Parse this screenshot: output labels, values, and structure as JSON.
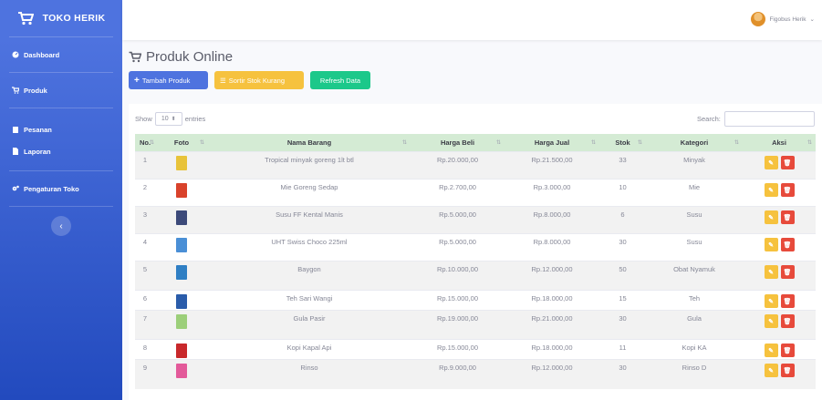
{
  "sidebar": {
    "brand": "TOKO HERIK",
    "items": [
      {
        "label": "Dashboard",
        "icon": "tachometer-icon"
      },
      {
        "label": "Produk",
        "icon": "cart-icon"
      },
      {
        "label": "Pesanan",
        "icon": "clipboard-icon"
      },
      {
        "label": "Laporan",
        "icon": "file-icon"
      },
      {
        "label": "Pengaturan Toko",
        "icon": "cogs-icon"
      }
    ],
    "toggle": "‹"
  },
  "topbar": {
    "user_name": "Figobus Herik"
  },
  "page": {
    "title": "Produk Online"
  },
  "buttons": {
    "add": "Tambah Produk",
    "sort": "Sortir Stok Kurang",
    "refresh": "Refresh Data"
  },
  "table_controls": {
    "show": "Show",
    "entries_value": "10",
    "entries": "entries",
    "search": "Search:"
  },
  "table": {
    "headers": [
      "No.",
      "Foto",
      "Nama Barang",
      "Harga Beli",
      "Harga Jual",
      "Stok",
      "Kategori",
      "Aksi"
    ],
    "rows": [
      {
        "no": "1",
        "nama": "Tropical minyak goreng 1lt btl",
        "beli": "Rp.20.000,00",
        "jual": "Rp.21.500,00",
        "stok": "33",
        "kategori": "Minyak",
        "photo_color": "#e8c33a"
      },
      {
        "no": "2",
        "nama": "Mie Goreng Sedap",
        "beli": "Rp.2.700,00",
        "jual": "Rp.3.000,00",
        "stok": "10",
        "kategori": "Mie",
        "photo_color": "#d9422b"
      },
      {
        "no": "3",
        "nama": "Susu FF Kental Manis",
        "beli": "Rp.5.000,00",
        "jual": "Rp.8.000,00",
        "stok": "6",
        "kategori": "Susu",
        "photo_color": "#3c4a7a"
      },
      {
        "no": "4",
        "nama": "UHT Swiss Choco 225ml",
        "beli": "Rp.5.000,00",
        "jual": "Rp.8.000,00",
        "stok": "30",
        "kategori": "Susu",
        "photo_color": "#4a8fd6"
      },
      {
        "no": "5",
        "nama": "Baygon",
        "beli": "Rp.10.000,00",
        "jual": "Rp.12.000,00",
        "stok": "50",
        "kategori": "Obat Nyamuk",
        "photo_color": "#2f7fc4"
      },
      {
        "no": "6",
        "nama": "Teh Sari Wangi",
        "beli": "Rp.15.000,00",
        "jual": "Rp.18.000,00",
        "stok": "15",
        "kategori": "Teh",
        "photo_color": "#2a5caa"
      },
      {
        "no": "7",
        "nama": "Gula Pasir",
        "beli": "Rp.19.000,00",
        "jual": "Rp.21.000,00",
        "stok": "30",
        "kategori": "Gula",
        "photo_color": "#9ccf7a"
      },
      {
        "no": "8",
        "nama": "Kopi Kapal Api",
        "beli": "Rp.15.000,00",
        "jual": "Rp.18.000,00",
        "stok": "11",
        "kategori": "Kopi KA",
        "photo_color": "#c8282b"
      },
      {
        "no": "9",
        "nama": "Rinso",
        "beli": "Rp.9.000,00",
        "jual": "Rp.12.000,00",
        "stok": "30",
        "kategori": "Rinso D",
        "photo_color": "#e35a9a"
      }
    ]
  }
}
